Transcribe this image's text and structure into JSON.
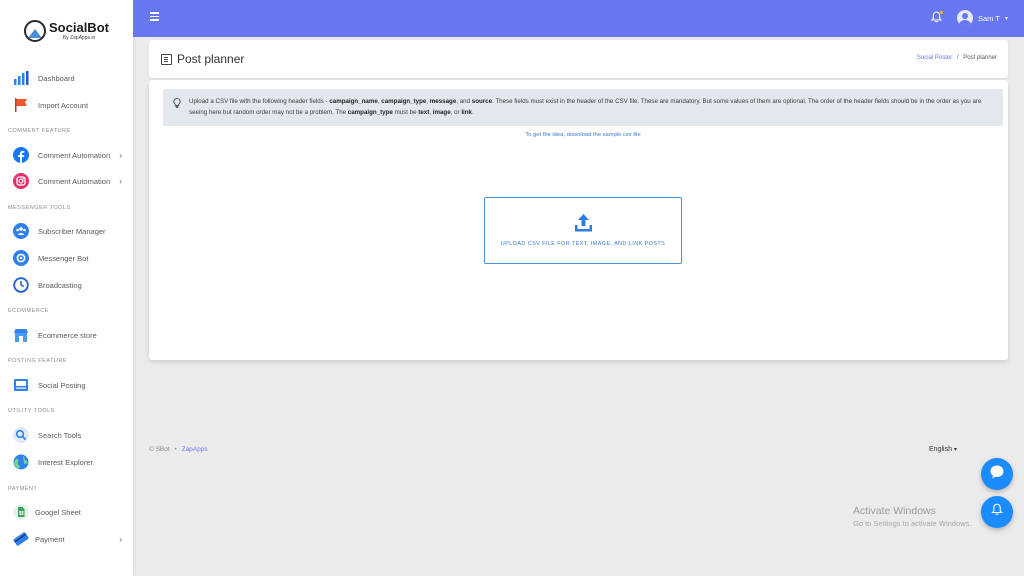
{
  "brand": {
    "name": "SocialBot",
    "tagline": "By ZapApps.io"
  },
  "sidebar": {
    "items": [
      {
        "label": "Dashboard",
        "icon": "bar-chart-icon",
        "color": "#2f80ed"
      },
      {
        "label": "Import Account",
        "icon": "flag-icon",
        "color": "#f2542d"
      },
      {
        "label": "Comment Automation",
        "icon": "facebook-icon",
        "color": "#1877f2",
        "chevron": "›"
      },
      {
        "label": "Comment Automation",
        "icon": "instagram-icon",
        "color": "#e1306c",
        "chevron": "›"
      },
      {
        "label": "Subscriber Manager",
        "icon": "users-icon",
        "color": "#2f80ed"
      },
      {
        "label": "Messenger Bot",
        "icon": "gear-icon",
        "color": "#2f80ed"
      },
      {
        "label": "Broadcasting",
        "icon": "clock-icon",
        "color": "#2f80ed"
      },
      {
        "label": "Ecommerce store",
        "icon": "store-icon",
        "color": "#2f80ed"
      },
      {
        "label": "Social Posting",
        "icon": "post-icon",
        "color": "#2f80ed"
      },
      {
        "label": "Search Tools",
        "icon": "search-icon",
        "color": "#2f80ed"
      },
      {
        "label": "Interest Explorer",
        "icon": "globe-icon",
        "color": "#2f80ed"
      },
      {
        "label": "Googel Sheet",
        "icon": "sheet-icon",
        "color": "#34a853"
      },
      {
        "label": "Payment",
        "icon": "card-icon",
        "color": "#2f80ed",
        "chevron": "›"
      }
    ],
    "sections": [
      "Comment feature",
      "Messenger tools",
      "Ecommerce",
      "Posting feature",
      "Utility tools",
      "Payment"
    ]
  },
  "topbar": {
    "user_name": "Sam T",
    "user_caret": "▾"
  },
  "header": {
    "title": "Post planner",
    "breadcrumb_parent": "Social Poster",
    "breadcrumb_sep": "/",
    "breadcrumb_current": "Post planner"
  },
  "alert": {
    "t1": "Upload a CSV file with the following header fields - ",
    "f1": "campaign_name",
    "c1": ", ",
    "f2": "campaign_type",
    "c2": ", ",
    "f3": "message",
    "c3": ", and ",
    "f4": "source",
    "t2": ". These fields must exist in the header of the CSV file. These are mandatory. But some values of them are optional. The order of the header fields should be in the order as you are seeing here but random order may not be a problem. The ",
    "f5": "campaign_type",
    "t3": " must be ",
    "v1": "text",
    "c4": ", ",
    "v2": "image",
    "c5": ", or ",
    "v3": "link",
    "t4": "."
  },
  "sample_link": "To get the idea, download the sample csv file",
  "upload": {
    "label": "Upload CSV file for text, image, and link posts"
  },
  "footer": {
    "copyright": "© SBot",
    "dot": "•",
    "company": "ZapApps",
    "language": "English",
    "language_caret": "▾"
  },
  "watermark": {
    "line1": "Activate Windows",
    "line2": "Go to Settings to activate Windows."
  }
}
